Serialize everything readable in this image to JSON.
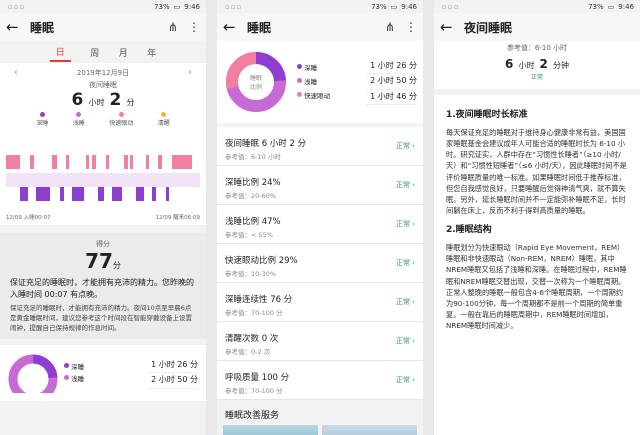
{
  "status": {
    "battery": "73%",
    "time": "9:46"
  },
  "panel1": {
    "title": "睡眠",
    "tabs": [
      "日",
      "周",
      "月",
      "年"
    ],
    "date": "2019年12月9日",
    "night_label": "夜间睡眠",
    "dur_h": "6",
    "dur_h_unit": "小时",
    "dur_m": "2",
    "dur_m_unit": "分",
    "legend": [
      {
        "label": "深睡",
        "color": "#8e3fd1"
      },
      {
        "label": "浅睡",
        "color": "#c66ad6"
      },
      {
        "label": "快速眼动",
        "color": "#f07fa0"
      },
      {
        "label": "清醒",
        "color": "#f0b343"
      }
    ],
    "start_label": "12/09 入睡00:07",
    "end_label": "12/09 醒来06:09",
    "score_label": "得分",
    "score": "77",
    "score_unit": "分",
    "advice_title": "保证充足的睡眠时，才能拥有充沛的精力。您昨晚的入睡时间 00:07 有点晚。",
    "advice_text": "保证充足的睡眠时，才能拥有充沛的精力。夜间10点至早晨6点是黄金睡眠时间，建议您参考这个时间段在智能穿戴设备上设置闹钟，提醒自己保持规律的作息时间。",
    "bottom_legend": [
      "深睡",
      "浅睡"
    ],
    "bottom_values": [
      "1 小时 26 分",
      "2 小时 50 分"
    ]
  },
  "panel2": {
    "title": "睡眠",
    "pie_center": "睡眠比例",
    "legend": [
      "深睡",
      "浅睡",
      "快速眼动"
    ],
    "values": [
      "1 小时 26 分",
      "2 小时 50 分",
      "1 小时 46 分"
    ],
    "items": [
      {
        "label": "夜间睡眠  6 小时 2 分",
        "ref": "参考值：6-10 小时",
        "status": "正常"
      },
      {
        "label": "深睡比例  24%",
        "ref": "参考值：20-60%",
        "status": "正常"
      },
      {
        "label": "浅睡比例  47%",
        "ref": "参考值：< 55%",
        "status": "正常"
      },
      {
        "label": "快速眼动比例  29%",
        "ref": "参考值：10-30%",
        "status": "正常"
      },
      {
        "label": "深睡连续性  76 分",
        "ref": "参考值：70-100 分",
        "status": "正常"
      },
      {
        "label": "清醒次数  0 次",
        "ref": "参考值：0-2 次",
        "status": "正常"
      },
      {
        "label": "呼吸质量  100 分",
        "ref": "参考值：70-100 分",
        "status": "正常"
      }
    ],
    "improve_title": "睡眠改善服务"
  },
  "panel3": {
    "title": "夜间睡眠",
    "ref": "参考值：6-10 小时",
    "dur_h": "6",
    "dur_h_unit": "小时",
    "dur_m": "2",
    "dur_m_unit": "分钟",
    "status": "正常",
    "sec1_title": "1.夜间睡眠时长标准",
    "sec1_text": "每天保证充足的睡眠对于维持身心健康非常有益，美国国家睡眠基金会建议成年人可能合适的睡眠时长为 6-10 小时。研究证实，人群中存在“习惯性长睡者”（≥10 小时/天）和“习惯性短睡者”（≤6 小时/天），因此睡眠时间不是评价睡眠质量的唯一标准。如果睡眠时间低于推荐标准，但您自我感觉良好，只要睡醒后觉得神清气爽，就不算失眠。另外，延长睡眠时间并不一定能弥补睡眠不足，长时间躺在床上，反而不利于得到高质量的睡眠。",
    "sec2_title": "2.睡眠结构",
    "sec2_text": "睡眠划分为快速眼动（Rapid Eye Movement，REM）睡眠和非快速眼动（Non-REM，NREM）睡眠，其中NREM睡眠又包括了浅睡和深睡。在睡眠过程中，REM睡眠和NREM睡眠交替出现，交替一次称为一个睡眠周期。正常人整晚的睡眠一般包含4-6个睡眠周期，一个周期约为90-100分钟，每一个周期都不是前一个周期的简单重复。一般在靠后的睡眠周期中，REM睡眠时间增加，NREM睡眠时间减少。"
  }
}
